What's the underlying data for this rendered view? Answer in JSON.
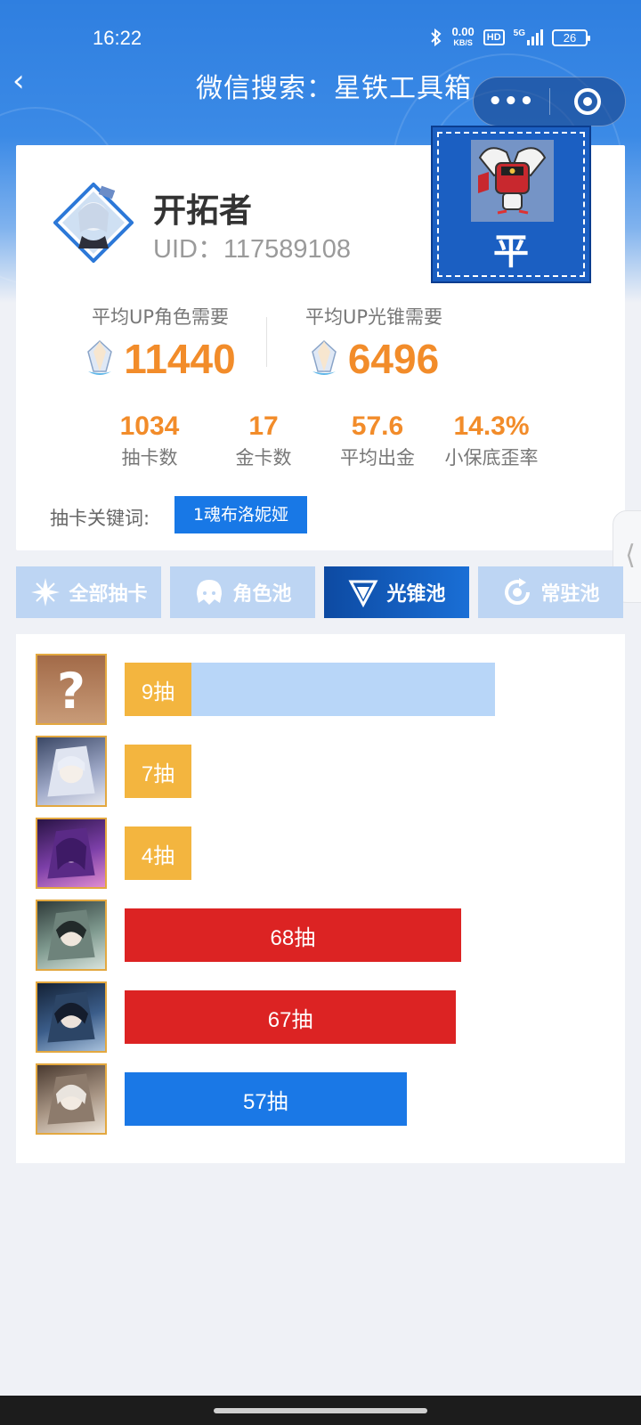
{
  "status_bar": {
    "time": "16:22",
    "net_speed_value": "0.00",
    "net_speed_unit": "KB/S",
    "hd_badge": "HD",
    "network_type": "5G",
    "battery": "26"
  },
  "nav": {
    "back_glyph": "‹",
    "title": "微信搜索：星铁工具箱",
    "more_glyph": "•••"
  },
  "profile": {
    "name": "开拓者",
    "uid": "UID：117589108",
    "badge_char": "平"
  },
  "stats": {
    "avg_char_label": "平均UP角色需要",
    "avg_char_value": "11440",
    "avg_cone_label": "平均UP光锥需要",
    "avg_cone_value": "6496",
    "small": [
      {
        "value": "1034",
        "label": "抽卡数"
      },
      {
        "value": "17",
        "label": "金卡数"
      },
      {
        "value": "57.6",
        "label": "平均出金"
      },
      {
        "value": "14.3%",
        "label": "小保底歪率"
      }
    ]
  },
  "keyword": {
    "label": "抽卡关键词:",
    "tag": "1魂布洛妮娅"
  },
  "side_tab_glyph": "⟨",
  "tabs": [
    {
      "label": "全部抽卡",
      "icon": "sparkle-icon",
      "active": false
    },
    {
      "label": "角色池",
      "icon": "character-icon",
      "active": false
    },
    {
      "label": "光锥池",
      "icon": "light-cone-icon",
      "active": true
    },
    {
      "label": "常驻池",
      "icon": "refresh-icon",
      "active": false
    }
  ],
  "pulls": {
    "max_pity": 90,
    "items": [
      {
        "label": "9抽",
        "pulls": 9,
        "type": "current",
        "fill_color": "#f3b53f",
        "track_pulls": 80
      },
      {
        "label": "7抽",
        "pulls": 7,
        "type": "gold",
        "fill_color": "#f3b53f"
      },
      {
        "label": "4抽",
        "pulls": 4,
        "type": "gold",
        "fill_color": "#f3b53f"
      },
      {
        "label": "68抽",
        "pulls": 68,
        "type": "lost",
        "fill_color": "#dc2323"
      },
      {
        "label": "67抽",
        "pulls": 67,
        "type": "lost",
        "fill_color": "#dc2323"
      },
      {
        "label": "57抽",
        "pulls": 57,
        "type": "normal",
        "fill_color": "#1a78e6"
      }
    ]
  },
  "colors": {
    "accent": "#f28c2a",
    "primary": "#1878e6",
    "tab_inactive": "#bdd5f3",
    "tab_active": "#0d4aa2"
  }
}
